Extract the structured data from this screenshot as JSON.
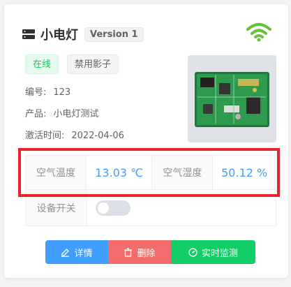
{
  "device": {
    "name": "小电灯",
    "version": "Version 1",
    "status_tag": "在线",
    "shadow_tag": "禁用影子",
    "fields": [
      {
        "label": "编号:",
        "value": "123"
      },
      {
        "label": "产品:",
        "value": "小电灯测试"
      },
      {
        "label": "激活时间:",
        "value": "2022-04-06"
      }
    ]
  },
  "metrics": {
    "temp_label": "空气温度",
    "temp_value": "13.03 ℃",
    "humidity_label": "空气湿度",
    "humidity_value": "50.12 %"
  },
  "switch_row": {
    "label": "设备开关",
    "state": "off"
  },
  "actions": {
    "detail_label": "详情",
    "delete_label": "删除",
    "monitor_label": "实时监测"
  },
  "colors": {
    "wifi": "#67c23a",
    "online": "#13ce66",
    "accent": "#409eff",
    "danger": "#f56c6c",
    "highlight": "#e8232e"
  },
  "icons": {
    "header": "server-icon",
    "status": "wifi-icon",
    "detail": "edit-icon",
    "delete": "trash-icon",
    "monitor": "gauge-icon"
  }
}
